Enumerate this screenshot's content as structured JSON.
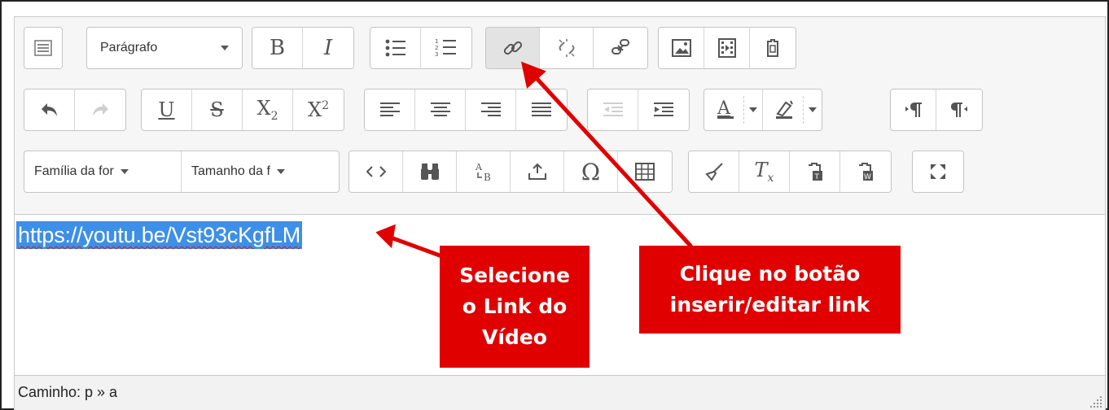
{
  "toolbar": {
    "format_select": "Parágrafo",
    "font_family_select": "Família da for",
    "font_size_select": "Tamanho da f",
    "bold": "B",
    "italic": "I",
    "underline": "U",
    "strikethrough": "S",
    "subscript_base": "X",
    "subscript_mark": "2",
    "superscript_base": "X",
    "superscript_mark": "2",
    "omega": "Ω",
    "clear_format_base": "T",
    "clear_format_mark": "x"
  },
  "content": {
    "selected_link": "https://youtu.be/Vst93cKgfLM"
  },
  "statusbar": {
    "path": "Caminho: p » a"
  },
  "callouts": {
    "select_link": [
      "Selecione",
      "o Link do",
      "Vídeo"
    ],
    "click_button": [
      "Clique no botão",
      "inserir/editar link"
    ]
  },
  "colors": {
    "callout_bg": "#e00000",
    "selection_bg": "#3d8fe8",
    "arrow": "#e00000"
  }
}
